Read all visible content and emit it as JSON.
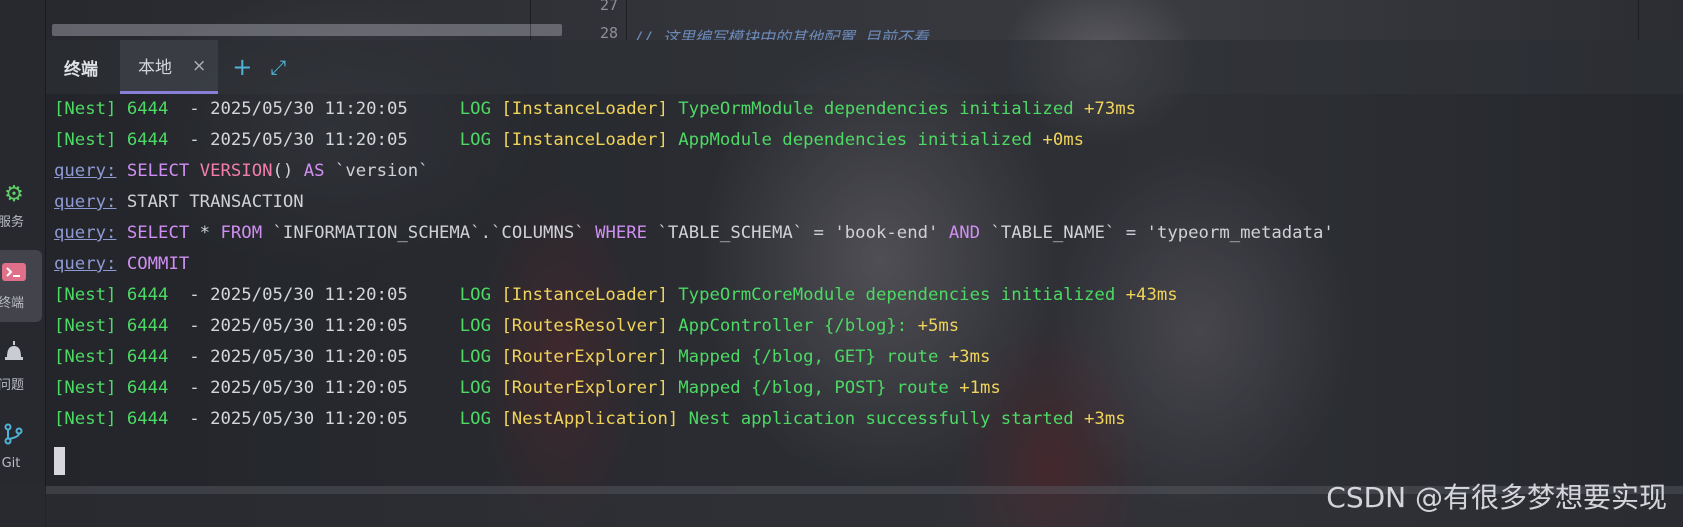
{
  "colors": {
    "nest_green": "#4cd964",
    "timing_yellow": "#f0d35a",
    "sql_keyword_purple": "#cf8ff2",
    "sql_function_pink": "#f27ea9",
    "query_label": "#8e9ad3",
    "tab_underline": "#8a7fd6",
    "tool_blue": "#4fb3d6"
  },
  "activity_bar": {
    "items": [
      {
        "icon": "gear-icon",
        "label": "服务",
        "active": false
      },
      {
        "icon": "terminal-icon",
        "label": "终端",
        "active": true
      },
      {
        "icon": "alert-icon",
        "label": "问题",
        "active": false
      },
      {
        "icon": "git-icon",
        "label": "Git",
        "active": false
      }
    ]
  },
  "editor": {
    "line_numbers": [
      "27",
      "28"
    ],
    "comment": "// 这里编写模块中的其他配置 目前不看"
  },
  "tabbar": {
    "title": "终端",
    "tab_label": "本地",
    "close_glyph": "×",
    "add_glyph": "+",
    "expand_glyph": "⤢"
  },
  "terminal": {
    "lines": [
      {
        "kind": "nest",
        "prefix": "[Nest]",
        "pid": "6444",
        "sep": "  - ",
        "timestamp": "2025/05/30 11:20:05",
        "level": "LOG",
        "context": "[InstanceLoader]",
        "message": "TypeOrmModule dependencies initialized",
        "timing": "+73ms"
      },
      {
        "kind": "nest",
        "prefix": "[Nest]",
        "pid": "6444",
        "sep": "  - ",
        "timestamp": "2025/05/30 11:20:05",
        "level": "LOG",
        "context": "[InstanceLoader]",
        "message": "AppModule dependencies initialized",
        "timing": "+0ms"
      },
      {
        "kind": "query",
        "label": "query:",
        "parts": [
          {
            "t": "SELECT",
            "c": "purple"
          },
          {
            "t": " ",
            "c": "plain"
          },
          {
            "t": "VERSION",
            "c": "pink"
          },
          {
            "t": "() ",
            "c": "plain"
          },
          {
            "t": "AS",
            "c": "purple"
          },
          {
            "t": " `version`",
            "c": "plain"
          }
        ]
      },
      {
        "kind": "query",
        "label": "query:",
        "parts": [
          {
            "t": "START TRANSACTION",
            "c": "plain"
          }
        ]
      },
      {
        "kind": "query",
        "label": "query:",
        "parts": [
          {
            "t": "SELECT",
            "c": "purple"
          },
          {
            "t": " * ",
            "c": "plain"
          },
          {
            "t": "FROM",
            "c": "purple"
          },
          {
            "t": " `INFORMATION_SCHEMA`.`COLUMNS` ",
            "c": "plain"
          },
          {
            "t": "WHERE",
            "c": "purple"
          },
          {
            "t": " `TABLE_SCHEMA` = 'book-end' ",
            "c": "plain"
          },
          {
            "t": "AND",
            "c": "purple"
          },
          {
            "t": " `TABLE_NAME` = 'typeorm_metadata'",
            "c": "plain"
          }
        ]
      },
      {
        "kind": "query",
        "label": "query:",
        "parts": [
          {
            "t": "COMMIT",
            "c": "purple"
          }
        ]
      },
      {
        "kind": "nest",
        "prefix": "[Nest]",
        "pid": "6444",
        "sep": "  - ",
        "timestamp": "2025/05/30 11:20:05",
        "level": "LOG",
        "context": "[InstanceLoader]",
        "message": "TypeOrmCoreModule dependencies initialized",
        "timing": "+43ms"
      },
      {
        "kind": "nest",
        "prefix": "[Nest]",
        "pid": "6444",
        "sep": "  - ",
        "timestamp": "2025/05/30 11:20:05",
        "level": "LOG",
        "context": "[RoutesResolver]",
        "message": "AppController {/blog}:",
        "timing": "+5ms"
      },
      {
        "kind": "nest",
        "prefix": "[Nest]",
        "pid": "6444",
        "sep": "  - ",
        "timestamp": "2025/05/30 11:20:05",
        "level": "LOG",
        "context": "[RouterExplorer]",
        "message": "Mapped {/blog, GET} route",
        "timing": "+3ms"
      },
      {
        "kind": "nest",
        "prefix": "[Nest]",
        "pid": "6444",
        "sep": "  - ",
        "timestamp": "2025/05/30 11:20:05",
        "level": "LOG",
        "context": "[RouterExplorer]",
        "message": "Mapped {/blog, POST} route",
        "timing": "+1ms"
      },
      {
        "kind": "nest",
        "prefix": "[Nest]",
        "pid": "6444",
        "sep": "  - ",
        "timestamp": "2025/05/30 11:20:05",
        "level": "LOG",
        "context": "[NestApplication]",
        "message": "Nest application successfully started",
        "timing": "+3ms"
      }
    ]
  },
  "watermark": "CSDN @有很多梦想要实现"
}
